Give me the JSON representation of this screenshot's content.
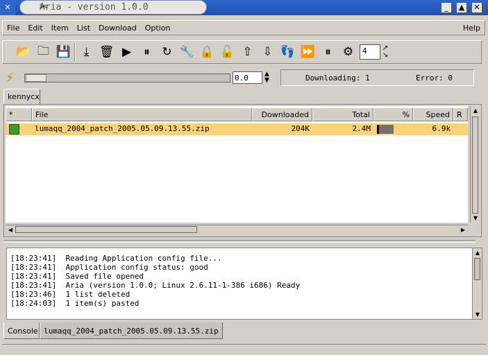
{
  "window": {
    "title": "Aria - version 1.0.0",
    "controls": [
      "_",
      "▲",
      "✕"
    ]
  },
  "menu": {
    "items": [
      "File",
      "Edit",
      "Item",
      "List",
      "Download",
      "Option"
    ],
    "help": "Help"
  },
  "toolbar": {
    "buttons": [
      {
        "icon": "open-folder-icon",
        "glyph": "📂"
      },
      {
        "icon": "new-folder-icon",
        "glyph": "🗀"
      },
      {
        "icon": "save-icon",
        "glyph": "💾"
      },
      {
        "icon": "import-icon",
        "glyph": "⤓"
      },
      {
        "icon": "trash-icon",
        "glyph": "🗑"
      },
      {
        "icon": "play-icon",
        "glyph": "▶"
      },
      {
        "icon": "pause-icon",
        "glyph": "⏸"
      },
      {
        "icon": "restart-icon",
        "glyph": "↻"
      },
      {
        "icon": "wrench-icon",
        "glyph": "🔧"
      },
      {
        "icon": "lock-icon",
        "glyph": "🔒"
      },
      {
        "icon": "unlock-icon",
        "glyph": "🔓"
      },
      {
        "icon": "move-up-icon",
        "glyph": "⇧"
      },
      {
        "icon": "move-down-icon",
        "glyph": "⇩"
      },
      {
        "icon": "footprints-icon",
        "glyph": "👣"
      },
      {
        "icon": "fast-forward-icon",
        "glyph": "⏩"
      },
      {
        "icon": "pause-all-icon",
        "glyph": "⏸"
      },
      {
        "icon": "settings-icon",
        "glyph": "⚙"
      }
    ],
    "thread_count": "4"
  },
  "speed": {
    "limit_value": "0.0",
    "downloading": "Downloading: 1",
    "error": "Error: 0"
  },
  "list_tab": "kennycx",
  "table": {
    "columns": [
      "*",
      "File",
      "Downloaded",
      "Total",
      "%",
      "Speed",
      "R"
    ],
    "rows": [
      {
        "file": "lumaqq_2004_patch_2005.05.09.13.55.zip",
        "downloaded": "204K",
        "total": "2.4M",
        "percent": 8,
        "speed": "6.9k"
      }
    ]
  },
  "console": {
    "lines": [
      "[18:23:41]  Reading Application config file...",
      "[18:23:41]  Application config status: good",
      "[18:23:41]  Saved file opened",
      "[18:23:41]  Aria (version 1.0.0; Linux 2.6.11-1-386 i686) Ready",
      "[18:23:46]  1 list deleted",
      "[18:24:03]  1 item(s) pasted"
    ]
  },
  "bottom_tabs": {
    "console": "Console",
    "file": "lumaqq_2004_patch_2005.05.09.13.55.zip"
  },
  "colors": {
    "title_bar": "#2f66cc",
    "selected_row": "#f9d27a",
    "progress_fill": "#757068"
  }
}
